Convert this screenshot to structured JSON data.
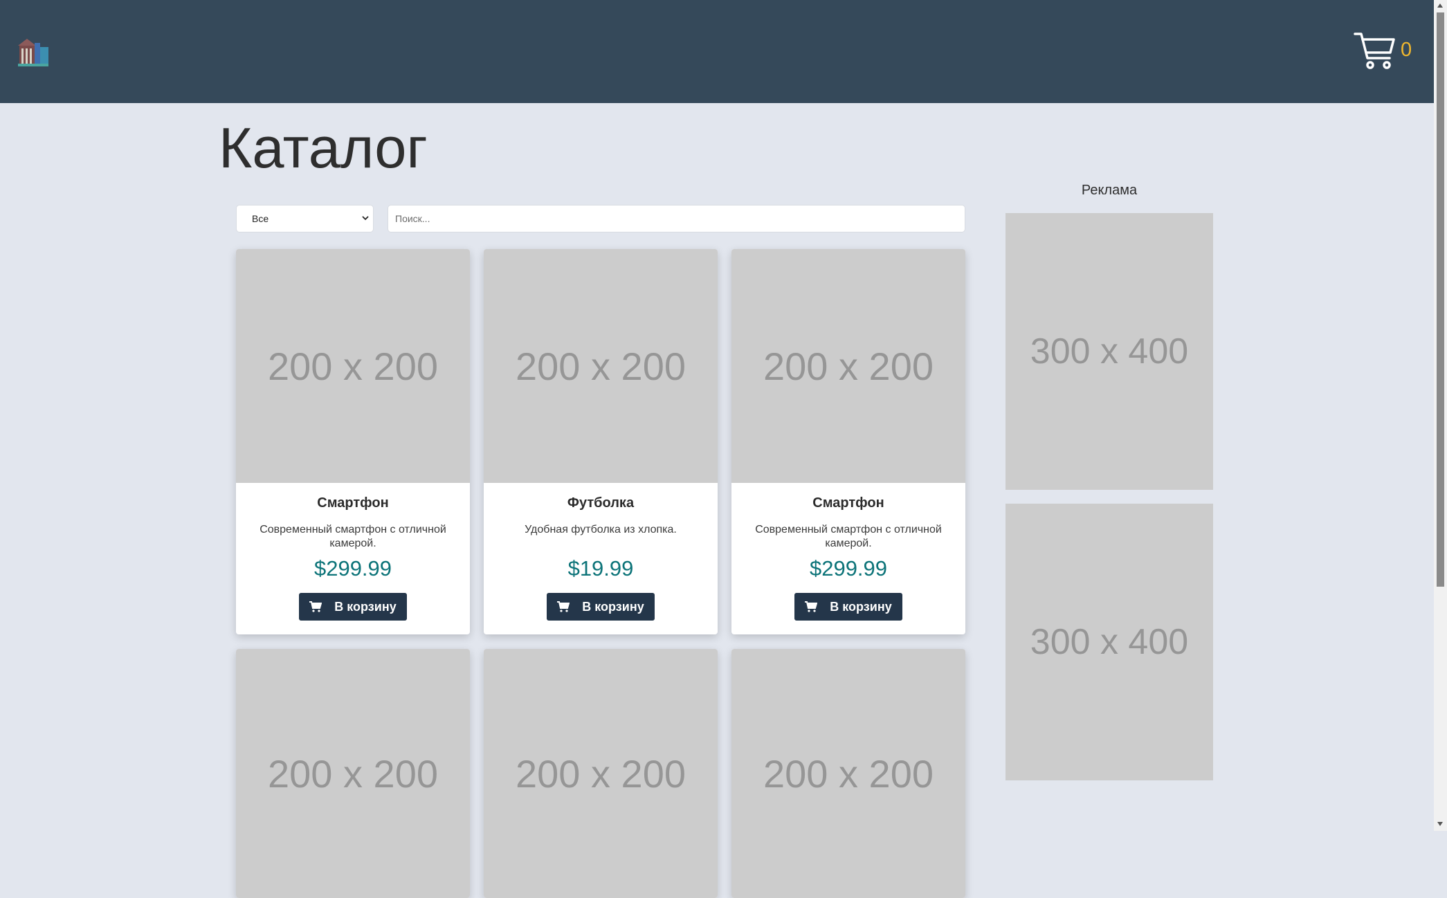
{
  "header": {
    "cart_count": "0"
  },
  "catalog": {
    "title": "Каталог",
    "filter": {
      "selected": "Все"
    },
    "search": {
      "placeholder": "Поиск..."
    },
    "products": [
      {
        "image_text": "200 x 200",
        "name": "Смартфон",
        "description": "Современный смартфон с отличной камерой.",
        "price": "$299.99",
        "button_label": "В корзину"
      },
      {
        "image_text": "200 x 200",
        "name": "Футболка",
        "description": "Удобная футболка из хлопка.",
        "price": "$19.99",
        "button_label": "В корзину"
      },
      {
        "image_text": "200 x 200",
        "name": "Смартфон",
        "description": "Современный смартфон с отличной камерой.",
        "price": "$299.99",
        "button_label": "В корзину"
      },
      {
        "image_text": "200 x 200"
      },
      {
        "image_text": "200 x 200"
      },
      {
        "image_text": "200 x 200"
      }
    ]
  },
  "ads": {
    "title": "Реклама",
    "banners": [
      "300 x 400",
      "300 x 400"
    ]
  },
  "colors": {
    "header_bg": "#35495a",
    "page_bg": "#e2e6ee",
    "price": "#0d7479",
    "button_bg": "#24364a",
    "cart_count": "#f0b72e"
  },
  "icons": [
    "logo-icon",
    "shopping-cart-icon",
    "cart-icon",
    "chevron-down-icon"
  ]
}
